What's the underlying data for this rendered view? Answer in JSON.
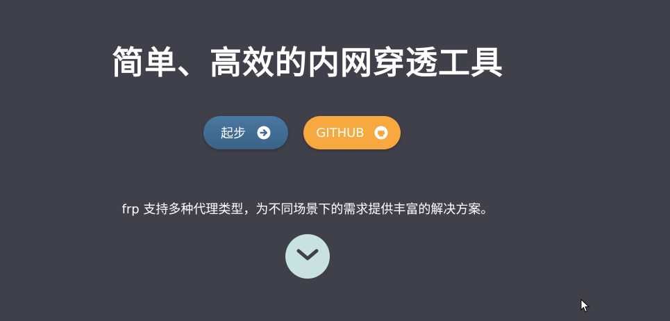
{
  "hero": {
    "title": "简单、高效的内网穿透工具",
    "tagline": "frp 支持多种代理类型，为不同场景下的需求提供丰富的解决方案。"
  },
  "buttons": {
    "start_label": "起步",
    "start_icon": "arrow-circle-right-icon",
    "github_label": "GITHUB",
    "github_icon": "github-icon"
  },
  "scroll": {
    "icon": "chevron-down-icon"
  },
  "colors": {
    "background": "#40404b",
    "start_button": "#3f6a91",
    "github_button": "#f7a83e",
    "scroll_button": "#c8e2df",
    "title_text": "#ffffff"
  }
}
